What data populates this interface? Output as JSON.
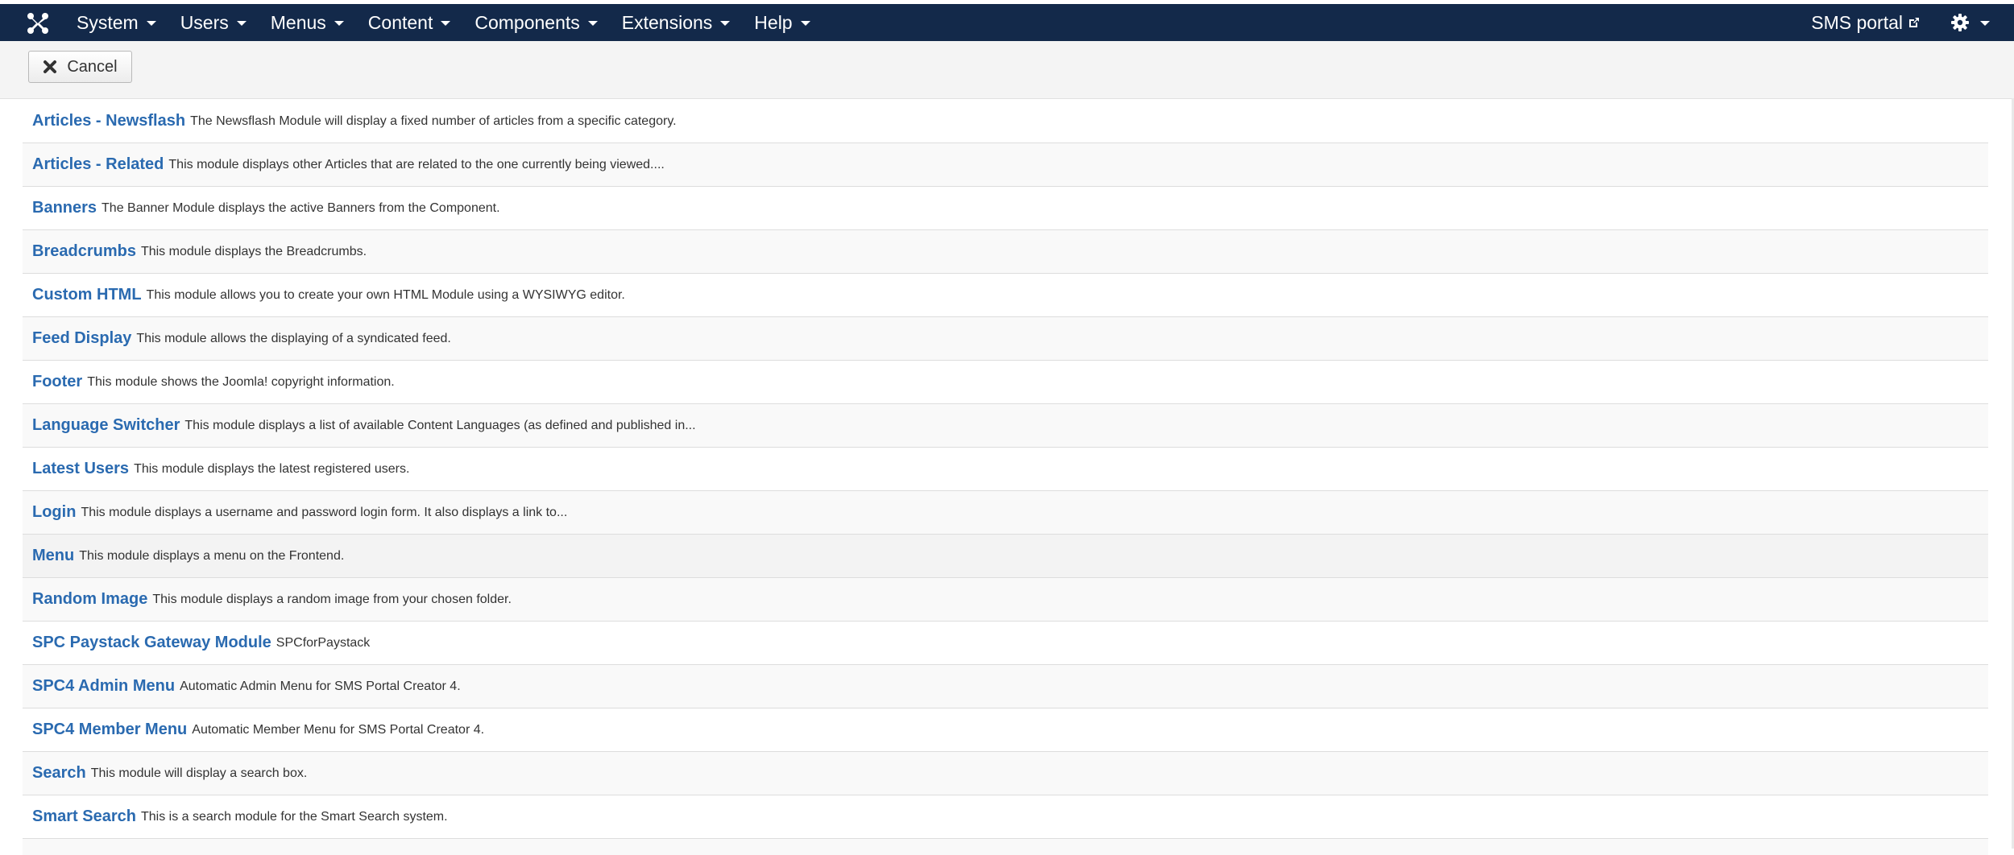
{
  "nav": {
    "items": [
      {
        "label": "System"
      },
      {
        "label": "Users"
      },
      {
        "label": "Menus"
      },
      {
        "label": "Content"
      },
      {
        "label": "Components"
      },
      {
        "label": "Extensions"
      },
      {
        "label": "Help"
      }
    ],
    "site_link": "SMS portal",
    "logo_icon": "joomla-logo-icon",
    "settings_icon": "gear-icon"
  },
  "toolbar": {
    "cancel_label": "Cancel"
  },
  "modules": [
    {
      "title": "Articles - Newsflash",
      "description": "The Newsflash Module will display a fixed number of articles from a specific category."
    },
    {
      "title": "Articles - Related",
      "description": "This module displays other Articles that are related to the one currently being viewed...."
    },
    {
      "title": "Banners",
      "description": "The Banner Module displays the active Banners from the Component."
    },
    {
      "title": "Breadcrumbs",
      "description": "This module displays the Breadcrumbs."
    },
    {
      "title": "Custom HTML",
      "description": "This module allows you to create your own HTML Module using a WYSIWYG editor."
    },
    {
      "title": "Feed Display",
      "description": "This module allows the displaying of a syndicated feed."
    },
    {
      "title": "Footer",
      "description": "This module shows the Joomla! copyright information."
    },
    {
      "title": "Language Switcher",
      "description": "This module displays a list of available Content Languages (as defined and published in..."
    },
    {
      "title": "Latest Users",
      "description": "This module displays the latest registered users."
    },
    {
      "title": "Login",
      "description": "This module displays a username and password login form. It also displays a link to..."
    },
    {
      "title": "Menu",
      "description": "This module displays a menu on the Frontend."
    },
    {
      "title": "Random Image",
      "description": "This module displays a random image from your chosen folder."
    },
    {
      "title": "SPC Paystack Gateway Module",
      "description": "SPCforPaystack"
    },
    {
      "title": "SPC4 Admin Menu",
      "description": "Automatic Admin Menu for SMS Portal Creator 4."
    },
    {
      "title": "SPC4 Member Menu",
      "description": "Automatic Member Menu for SMS Portal Creator 4."
    },
    {
      "title": "Search",
      "description": "This module will display a search box."
    },
    {
      "title": "Smart Search",
      "description": "This is a search module for the Smart Search system."
    }
  ]
}
